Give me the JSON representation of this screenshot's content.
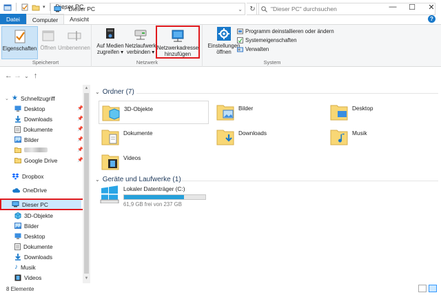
{
  "window": {
    "title": "Dieser PC",
    "minimize": "—",
    "maximize": "☐",
    "close": "✕"
  },
  "tabs": [
    {
      "label": "Datei"
    },
    {
      "label": "Computer"
    },
    {
      "label": "Ansicht"
    }
  ],
  "ribbon": {
    "groups": {
      "location": {
        "label": "Speicherort",
        "buttons": [
          "Eigenschaften",
          "Öffnen",
          "Umbenennen"
        ]
      },
      "network": {
        "label": "Netzwerk",
        "access_media": [
          "Auf Medien",
          "zugreifen ▾"
        ],
        "map_drive": [
          "Netzlaufwerk",
          "verbinden ▾"
        ],
        "add_network": [
          "Netzwerkadresse",
          "hinzufügen"
        ]
      },
      "system": {
        "label": "System",
        "settings": [
          "Einstellungen",
          "öffnen"
        ],
        "items": [
          "Programm deinstallieren oder ändern",
          "Systemeigenschaften",
          "Verwalten"
        ]
      }
    }
  },
  "address": {
    "path": "Dieser PC",
    "back": "←",
    "forward": "→",
    "recent": "⌄",
    "up": "↑",
    "refresh": "↻",
    "search_placeholder": "\"Dieser PC\" durchsuchen"
  },
  "sidebar": {
    "quick_access": "Schnellzugriff",
    "quick_items": [
      "Desktop",
      "Downloads",
      "Dokumente",
      "Bilder",
      "Google Drive"
    ],
    "dropbox": "Dropbox",
    "onedrive": "OneDrive",
    "this_pc": "Dieser PC",
    "pc_items": [
      "3D-Objekte",
      "Bilder",
      "Desktop",
      "Dokumente",
      "Downloads",
      "Musik",
      "Videos"
    ]
  },
  "main": {
    "folders_header": "Ordner (7)",
    "folders": [
      "3D-Objekte",
      "Bilder",
      "Desktop",
      "Dokumente",
      "Downloads",
      "Musik",
      "Videos"
    ],
    "drives_header": "Geräte und Laufwerke (1)",
    "drive": {
      "name": "Lokaler Datenträger (C:)",
      "detail": "61,9 GB frei von 237 GB",
      "used_fraction": 0.74
    }
  },
  "status": {
    "count": "8 Elemente"
  },
  "colors": {
    "accent": "#1979ca",
    "highlight": "#e0191d",
    "selection": "#cce8ff",
    "folder": "#f8d775"
  }
}
